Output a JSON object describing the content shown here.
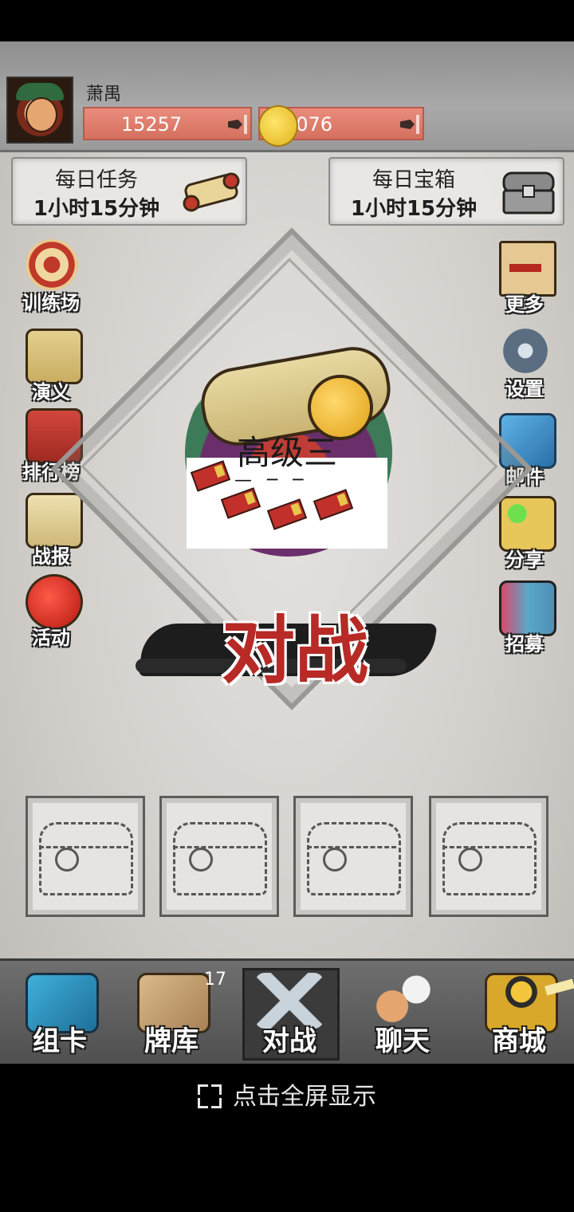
{
  "player": {
    "name": "萧禺",
    "stat_a": "15257",
    "stat_b": "1076"
  },
  "daily_task": {
    "title": "每日任务",
    "timer": "1小时15分钟"
  },
  "daily_chest": {
    "title": "每日宝箱",
    "timer": "1小时15分钟"
  },
  "left_menu": [
    {
      "label": "训练场"
    },
    {
      "label": "演义"
    },
    {
      "label": "排行榜"
    },
    {
      "label": "战报"
    },
    {
      "label": "活动"
    }
  ],
  "right_menu": [
    {
      "label": "更多"
    },
    {
      "label": "设置"
    },
    {
      "label": "邮件"
    },
    {
      "label": "分享"
    },
    {
      "label": "招募"
    }
  ],
  "rank": {
    "name": "高级三",
    "marks": "— ─ ─"
  },
  "battle_button": "对战",
  "nav": {
    "items": [
      {
        "label": "组卡"
      },
      {
        "label": "牌库"
      },
      {
        "label": "对战"
      },
      {
        "label": "聊天"
      },
      {
        "label": "商城"
      }
    ],
    "badge": "17"
  },
  "fullscreen_prompt": "点击全屏显示",
  "colors": {
    "battle_red": "#b72a26",
    "stat_bar": "#d5705f"
  }
}
